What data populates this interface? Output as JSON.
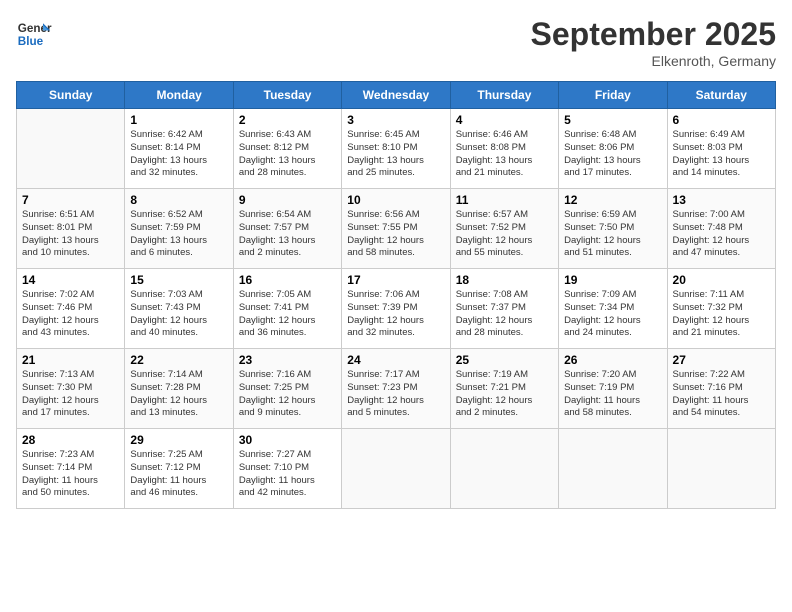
{
  "header": {
    "logo_line1": "General",
    "logo_line2": "Blue",
    "month": "September 2025",
    "location": "Elkenroth, Germany"
  },
  "days_of_week": [
    "Sunday",
    "Monday",
    "Tuesday",
    "Wednesday",
    "Thursday",
    "Friday",
    "Saturday"
  ],
  "weeks": [
    [
      {
        "date": "",
        "info": ""
      },
      {
        "date": "1",
        "info": "Sunrise: 6:42 AM\nSunset: 8:14 PM\nDaylight: 13 hours\nand 32 minutes."
      },
      {
        "date": "2",
        "info": "Sunrise: 6:43 AM\nSunset: 8:12 PM\nDaylight: 13 hours\nand 28 minutes."
      },
      {
        "date": "3",
        "info": "Sunrise: 6:45 AM\nSunset: 8:10 PM\nDaylight: 13 hours\nand 25 minutes."
      },
      {
        "date": "4",
        "info": "Sunrise: 6:46 AM\nSunset: 8:08 PM\nDaylight: 13 hours\nand 21 minutes."
      },
      {
        "date": "5",
        "info": "Sunrise: 6:48 AM\nSunset: 8:06 PM\nDaylight: 13 hours\nand 17 minutes."
      },
      {
        "date": "6",
        "info": "Sunrise: 6:49 AM\nSunset: 8:03 PM\nDaylight: 13 hours\nand 14 minutes."
      }
    ],
    [
      {
        "date": "7",
        "info": "Sunrise: 6:51 AM\nSunset: 8:01 PM\nDaylight: 13 hours\nand 10 minutes."
      },
      {
        "date": "8",
        "info": "Sunrise: 6:52 AM\nSunset: 7:59 PM\nDaylight: 13 hours\nand 6 minutes."
      },
      {
        "date": "9",
        "info": "Sunrise: 6:54 AM\nSunset: 7:57 PM\nDaylight: 13 hours\nand 2 minutes."
      },
      {
        "date": "10",
        "info": "Sunrise: 6:56 AM\nSunset: 7:55 PM\nDaylight: 12 hours\nand 58 minutes."
      },
      {
        "date": "11",
        "info": "Sunrise: 6:57 AM\nSunset: 7:52 PM\nDaylight: 12 hours\nand 55 minutes."
      },
      {
        "date": "12",
        "info": "Sunrise: 6:59 AM\nSunset: 7:50 PM\nDaylight: 12 hours\nand 51 minutes."
      },
      {
        "date": "13",
        "info": "Sunrise: 7:00 AM\nSunset: 7:48 PM\nDaylight: 12 hours\nand 47 minutes."
      }
    ],
    [
      {
        "date": "14",
        "info": "Sunrise: 7:02 AM\nSunset: 7:46 PM\nDaylight: 12 hours\nand 43 minutes."
      },
      {
        "date": "15",
        "info": "Sunrise: 7:03 AM\nSunset: 7:43 PM\nDaylight: 12 hours\nand 40 minutes."
      },
      {
        "date": "16",
        "info": "Sunrise: 7:05 AM\nSunset: 7:41 PM\nDaylight: 12 hours\nand 36 minutes."
      },
      {
        "date": "17",
        "info": "Sunrise: 7:06 AM\nSunset: 7:39 PM\nDaylight: 12 hours\nand 32 minutes."
      },
      {
        "date": "18",
        "info": "Sunrise: 7:08 AM\nSunset: 7:37 PM\nDaylight: 12 hours\nand 28 minutes."
      },
      {
        "date": "19",
        "info": "Sunrise: 7:09 AM\nSunset: 7:34 PM\nDaylight: 12 hours\nand 24 minutes."
      },
      {
        "date": "20",
        "info": "Sunrise: 7:11 AM\nSunset: 7:32 PM\nDaylight: 12 hours\nand 21 minutes."
      }
    ],
    [
      {
        "date": "21",
        "info": "Sunrise: 7:13 AM\nSunset: 7:30 PM\nDaylight: 12 hours\nand 17 minutes."
      },
      {
        "date": "22",
        "info": "Sunrise: 7:14 AM\nSunset: 7:28 PM\nDaylight: 12 hours\nand 13 minutes."
      },
      {
        "date": "23",
        "info": "Sunrise: 7:16 AM\nSunset: 7:25 PM\nDaylight: 12 hours\nand 9 minutes."
      },
      {
        "date": "24",
        "info": "Sunrise: 7:17 AM\nSunset: 7:23 PM\nDaylight: 12 hours\nand 5 minutes."
      },
      {
        "date": "25",
        "info": "Sunrise: 7:19 AM\nSunset: 7:21 PM\nDaylight: 12 hours\nand 2 minutes."
      },
      {
        "date": "26",
        "info": "Sunrise: 7:20 AM\nSunset: 7:19 PM\nDaylight: 11 hours\nand 58 minutes."
      },
      {
        "date": "27",
        "info": "Sunrise: 7:22 AM\nSunset: 7:16 PM\nDaylight: 11 hours\nand 54 minutes."
      }
    ],
    [
      {
        "date": "28",
        "info": "Sunrise: 7:23 AM\nSunset: 7:14 PM\nDaylight: 11 hours\nand 50 minutes."
      },
      {
        "date": "29",
        "info": "Sunrise: 7:25 AM\nSunset: 7:12 PM\nDaylight: 11 hours\nand 46 minutes."
      },
      {
        "date": "30",
        "info": "Sunrise: 7:27 AM\nSunset: 7:10 PM\nDaylight: 11 hours\nand 42 minutes."
      },
      {
        "date": "",
        "info": ""
      },
      {
        "date": "",
        "info": ""
      },
      {
        "date": "",
        "info": ""
      },
      {
        "date": "",
        "info": ""
      }
    ]
  ]
}
